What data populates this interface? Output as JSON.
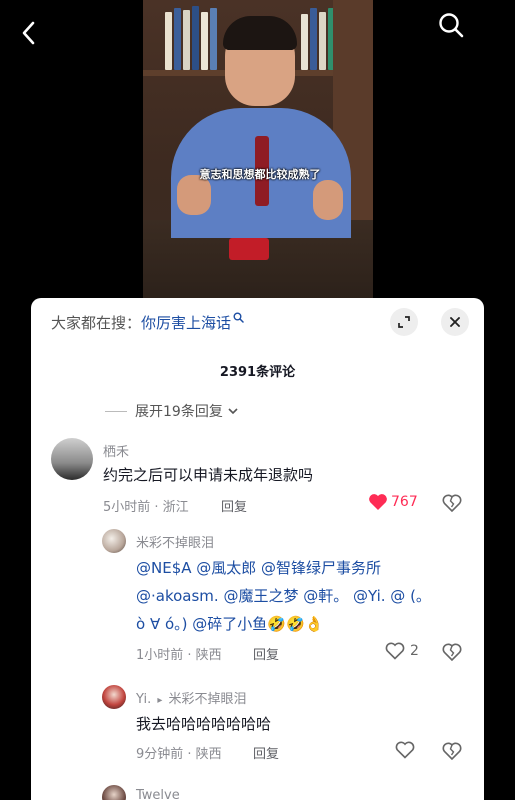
{
  "video": {
    "subtitle": "意志和思想都比较成熟了"
  },
  "top_bar": {
    "back_icon": "chevron-left-icon",
    "search_icon": "search-icon"
  },
  "comments_panel": {
    "suggest_prefix": "大家都在搜：",
    "suggest_keyword": "你厉害上海话",
    "comment_count": "2391条评论",
    "expand_replies": "展开19条回复",
    "colors": {
      "accent_link": "#1d4ea3",
      "like_red": "#fe2c55"
    },
    "comments": [
      {
        "username": "栖禾",
        "text": "约完之后可以申请未成年退款吗",
        "time_location": "5小时前 · 浙江",
        "reply_label": "回复",
        "likes": "767",
        "liked": true
      }
    ],
    "replies": [
      {
        "username": "米彩不掉眼泪",
        "line1": "@NE$A @風太郎 @智锋绿尸事务所",
        "line2": "@·akoasm. @魔王之梦 @軒。 @Yi. @ (。",
        "line3_mentions": "ò ∀ ó。) @碎了小鱼",
        "line3_emoji": "🤣🤣👌",
        "time_location": "1小时前 · 陕西",
        "reply_label": "回复",
        "likes": "2",
        "liked": false
      },
      {
        "username": "Yi.",
        "reply_to_arrow": "▸",
        "reply_to": "米彩不掉眼泪",
        "text": "我去哈哈哈哈哈哈哈",
        "time_location": "9分钟前 · 陕西",
        "reply_label": "回复",
        "likes": "",
        "liked": false
      },
      {
        "username": "Twelve"
      }
    ]
  }
}
